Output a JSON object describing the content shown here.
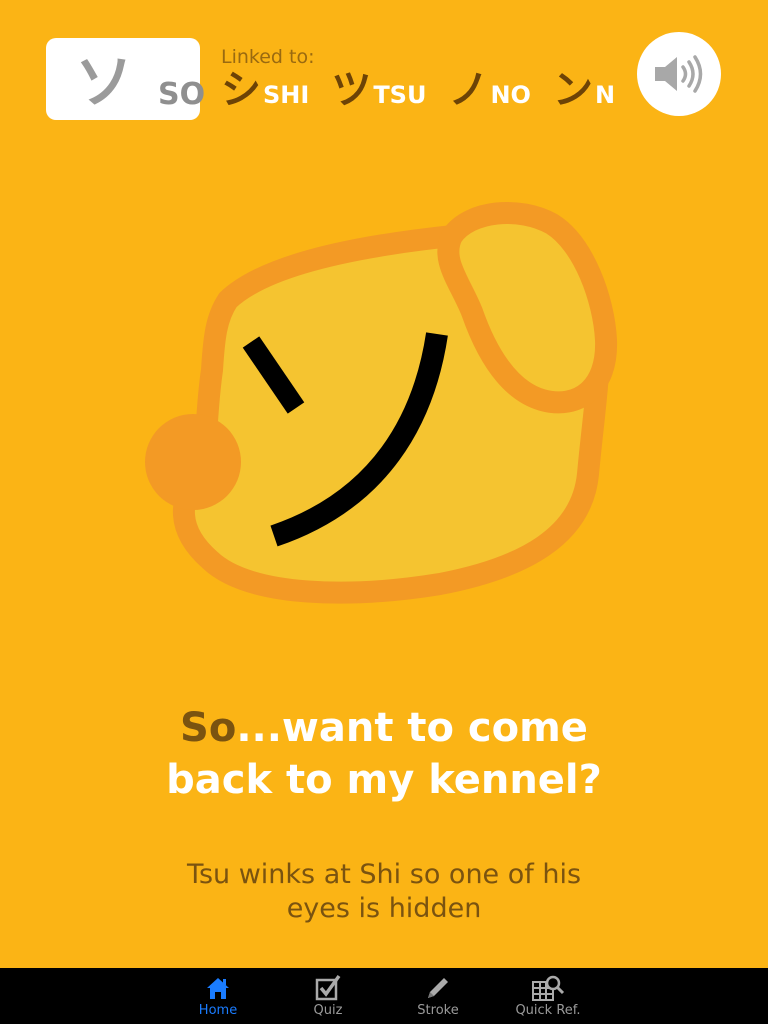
{
  "kana_card": {
    "glyph": "ソ",
    "romaji": "SO"
  },
  "linked": {
    "label": "Linked to:",
    "items": [
      {
        "kana": "シ",
        "romaji": "SHI"
      },
      {
        "kana": "ツ",
        "romaji": "TSU"
      },
      {
        "kana": "ノ",
        "romaji": "NO"
      },
      {
        "kana": "ン",
        "romaji": "N"
      }
    ]
  },
  "sound_button": {
    "icon": "speaker-icon"
  },
  "illustration": {
    "glyph": "ソ",
    "description_icon": "dog-head"
  },
  "mnemonic": {
    "accent": "So",
    "line1_rest": "...want to come",
    "line2": "back to my kennel?",
    "explanation": "Tsu winks at Shi so one of his eyes is hidden"
  },
  "tabbar": {
    "tabs": [
      {
        "label": "Home",
        "icon": "home-icon",
        "active": true
      },
      {
        "label": "Quiz",
        "icon": "checkbox-icon",
        "active": false
      },
      {
        "label": "Stroke",
        "icon": "pencil-icon",
        "active": false
      },
      {
        "label": "Quick Ref.",
        "icon": "grid-search-icon",
        "active": false
      }
    ]
  },
  "colors": {
    "background": "#fbb415",
    "dog_fill": "#f5c430",
    "dog_outline": "#f39a25",
    "accent_text": "#7a5310",
    "active_tab": "#1a7cff"
  }
}
